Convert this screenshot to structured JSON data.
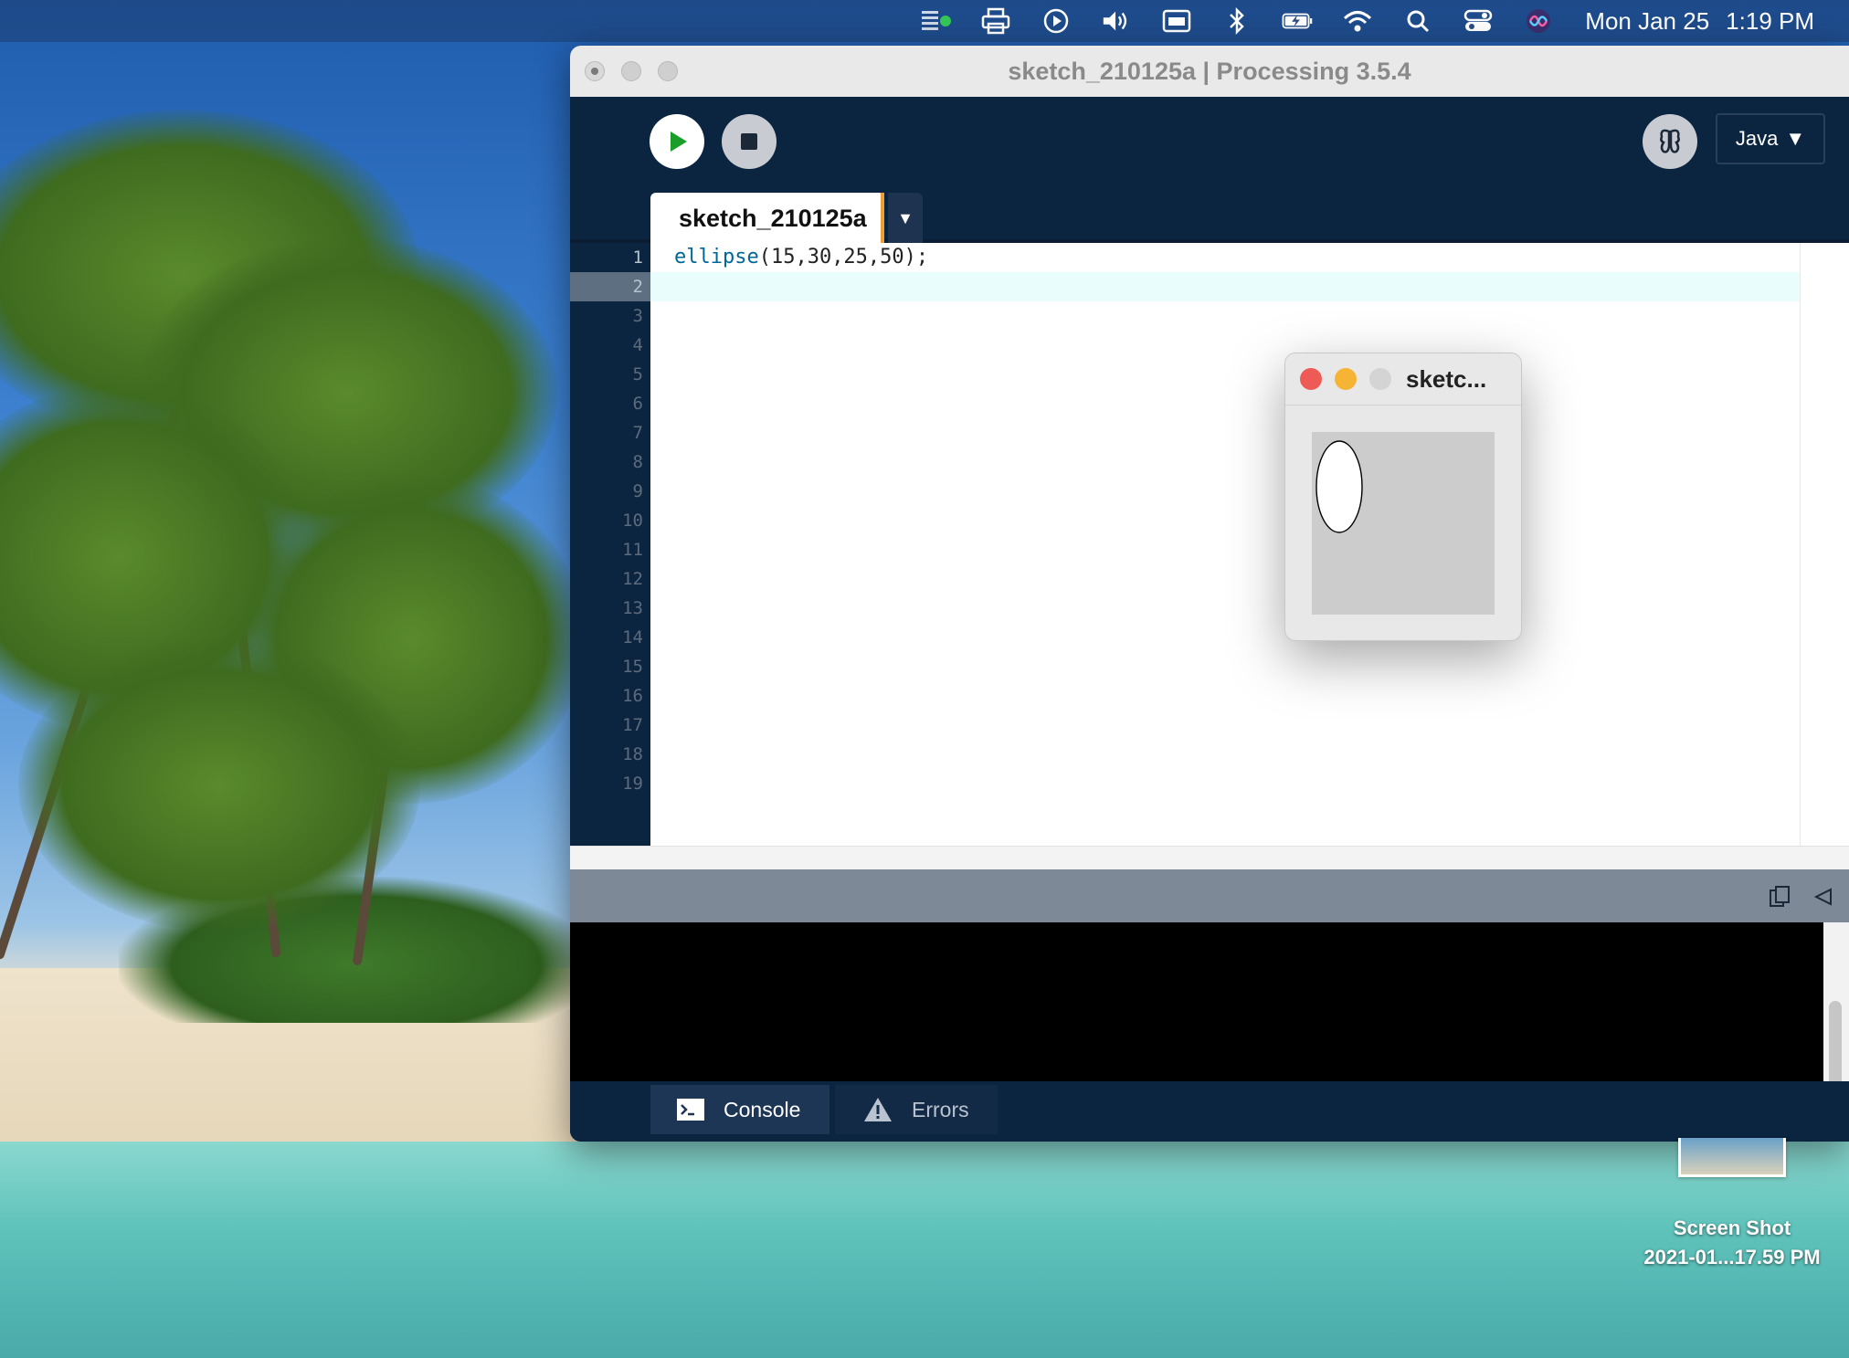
{
  "menubar": {
    "date": "Mon Jan 25",
    "time": "1:19 PM"
  },
  "processing": {
    "title": "sketch_210125a | Processing 3.5.4",
    "mode": "Java",
    "tab_name": "sketch_210125a",
    "code_lines": [
      {
        "fn": "ellipse",
        "args": "(15,30,25,50);"
      },
      {
        "fn": "",
        "args": ""
      }
    ],
    "line_numbers": [
      "1",
      "2",
      "3",
      "4",
      "5",
      "6",
      "7",
      "8",
      "9",
      "10",
      "11",
      "12",
      "13",
      "14",
      "15",
      "16",
      "17",
      "18",
      "19"
    ],
    "console_tab": "Console",
    "errors_tab": "Errors"
  },
  "sketch_window": {
    "title": "sketc...",
    "ellipse": {
      "x": 15,
      "y": 30,
      "w": 25,
      "h": 50
    }
  },
  "desktop_file": {
    "line1": "Screen Shot",
    "line2": "2021-01...17.59 PM"
  }
}
